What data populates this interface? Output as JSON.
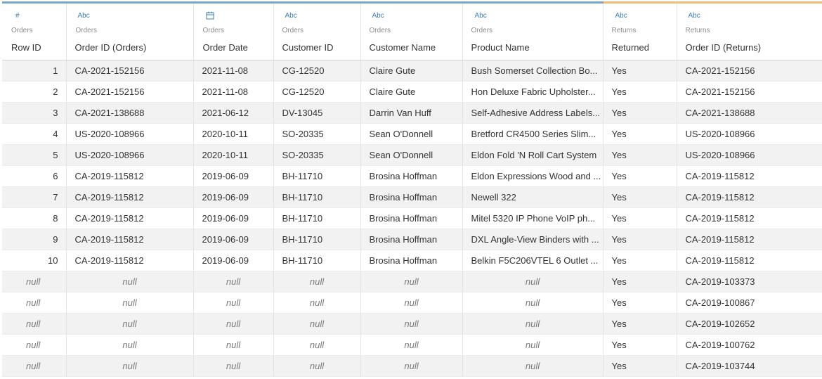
{
  "columns": [
    {
      "type_icon": "#",
      "type_name": "number-icon",
      "source": "Orders",
      "name": "Row ID"
    },
    {
      "type_icon": "Abc",
      "type_name": "string-icon",
      "source": "Orders",
      "name": "Order ID (Orders)"
    },
    {
      "type_icon": "",
      "type_name": "calendar-icon",
      "source": "Orders",
      "name": "Order Date"
    },
    {
      "type_icon": "Abc",
      "type_name": "string-icon",
      "source": "Orders",
      "name": "Customer ID"
    },
    {
      "type_icon": "Abc",
      "type_name": "string-icon",
      "source": "Orders",
      "name": "Customer Name"
    },
    {
      "type_icon": "Abc",
      "type_name": "string-icon",
      "source": "Orders",
      "name": "Product Name"
    },
    {
      "type_icon": "Abc",
      "type_name": "string-icon",
      "source": "Returns",
      "name": "Returned"
    },
    {
      "type_icon": "Abc",
      "type_name": "string-icon",
      "source": "Returns",
      "name": "Order ID (Returns)"
    }
  ],
  "colors": {
    "orders_accent": "#7aa6c8",
    "returns_accent": "#f0bd77",
    "type_icon": "#3f7fae"
  },
  "rows": [
    [
      "1",
      "CA-2021-152156",
      "2021-11-08",
      "CG-12520",
      "Claire Gute",
      "Bush Somerset Collection Bo...",
      "Yes",
      "CA-2021-152156"
    ],
    [
      "2",
      "CA-2021-152156",
      "2021-11-08",
      "CG-12520",
      "Claire Gute",
      "Hon Deluxe Fabric Upholster...",
      "Yes",
      "CA-2021-152156"
    ],
    [
      "3",
      "CA-2021-138688",
      "2021-06-12",
      "DV-13045",
      "Darrin Van Huff",
      "Self-Adhesive Address Labels...",
      "Yes",
      "CA-2021-138688"
    ],
    [
      "4",
      "US-2020-108966",
      "2020-10-11",
      "SO-20335",
      "Sean O'Donnell",
      "Bretford CR4500 Series Slim...",
      "Yes",
      "US-2020-108966"
    ],
    [
      "5",
      "US-2020-108966",
      "2020-10-11",
      "SO-20335",
      "Sean O'Donnell",
      "Eldon Fold 'N Roll Cart System",
      "Yes",
      "US-2020-108966"
    ],
    [
      "6",
      "CA-2019-115812",
      "2019-06-09",
      "BH-11710",
      "Brosina Hoffman",
      "Eldon Expressions Wood and ...",
      "Yes",
      "CA-2019-115812"
    ],
    [
      "7",
      "CA-2019-115812",
      "2019-06-09",
      "BH-11710",
      "Brosina Hoffman",
      "Newell 322",
      "Yes",
      "CA-2019-115812"
    ],
    [
      "8",
      "CA-2019-115812",
      "2019-06-09",
      "BH-11710",
      "Brosina Hoffman",
      "Mitel 5320 IP Phone VoIP ph...",
      "Yes",
      "CA-2019-115812"
    ],
    [
      "9",
      "CA-2019-115812",
      "2019-06-09",
      "BH-11710",
      "Brosina Hoffman",
      "DXL Angle-View Binders with ...",
      "Yes",
      "CA-2019-115812"
    ],
    [
      "10",
      "CA-2019-115812",
      "2019-06-09",
      "BH-11710",
      "Brosina Hoffman",
      "Belkin F5C206VTEL 6 Outlet ...",
      "Yes",
      "CA-2019-115812"
    ],
    [
      "null",
      "null",
      "null",
      "null",
      "null",
      "null",
      "Yes",
      "CA-2019-103373"
    ],
    [
      "null",
      "null",
      "null",
      "null",
      "null",
      "null",
      "Yes",
      "CA-2019-100867"
    ],
    [
      "null",
      "null",
      "null",
      "null",
      "null",
      "null",
      "Yes",
      "CA-2019-102652"
    ],
    [
      "null",
      "null",
      "null",
      "null",
      "null",
      "null",
      "Yes",
      "CA-2019-100762"
    ],
    [
      "null",
      "null",
      "null",
      "null",
      "null",
      "null",
      "Yes",
      "CA-2019-103744"
    ]
  ]
}
